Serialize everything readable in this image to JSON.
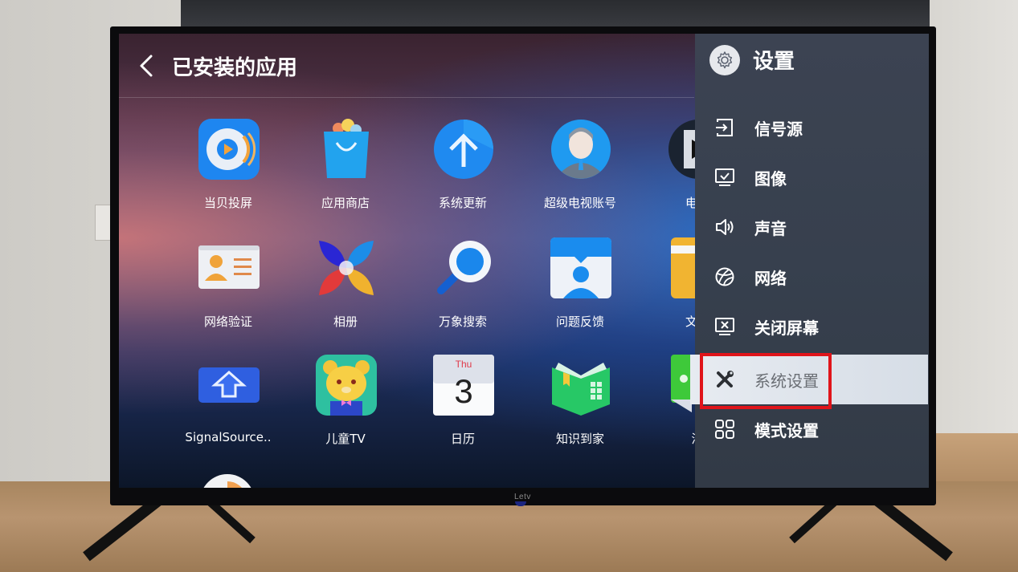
{
  "page": {
    "title": "已安装的应用",
    "back_label": "back"
  },
  "apps": [
    {
      "label": "当贝投屏",
      "icon": "dangbei-cast-icon"
    },
    {
      "label": "应用商店",
      "icon": "app-store-bag-icon"
    },
    {
      "label": "系统更新",
      "icon": "system-update-arrow-icon"
    },
    {
      "label": "超级电视账号",
      "icon": "tv-account-avatar-icon"
    },
    {
      "label": "电视",
      "icon": "tv-player-icon"
    },
    {
      "label": "网络验证",
      "icon": "network-auth-card-icon"
    },
    {
      "label": "相册",
      "icon": "album-petals-icon"
    },
    {
      "label": "万象搜索",
      "icon": "search-magnifier-icon"
    },
    {
      "label": "问题反馈",
      "icon": "feedback-person-icon"
    },
    {
      "label": "文件",
      "icon": "folder-icon"
    },
    {
      "label": "SignalSource..",
      "icon": "signal-source-arrow-icon"
    },
    {
      "label": "儿童TV",
      "icon": "kids-bear-icon"
    },
    {
      "label": "日历",
      "icon": "calendar-icon"
    },
    {
      "label": "知识到家",
      "icon": "knowledge-book-icon"
    },
    {
      "label": "消",
      "icon": "message-green-icon"
    }
  ],
  "calendar_icon": {
    "weekday": "Thu",
    "day": "3"
  },
  "settings_panel": {
    "title": "设置",
    "items": [
      {
        "label": "信号源",
        "icon": "input-source-icon"
      },
      {
        "label": "图像",
        "icon": "picture-monitor-icon"
      },
      {
        "label": "声音",
        "icon": "speaker-icon"
      },
      {
        "label": "网络",
        "icon": "network-globe-icon"
      },
      {
        "label": "关闭屏幕",
        "icon": "screen-off-icon"
      },
      {
        "label": "系统设置",
        "icon": "tools-wrench-icon",
        "selected": true
      },
      {
        "label": "模式设置",
        "icon": "mode-grid-icon"
      }
    ],
    "selected_index": 5
  },
  "tv": {
    "brand": "Letv"
  },
  "colors": {
    "panel_bg": "#3a4250",
    "selected_bg": "#e3e8ee",
    "highlight_border": "#e0141a",
    "text_primary": "#ffffff"
  }
}
